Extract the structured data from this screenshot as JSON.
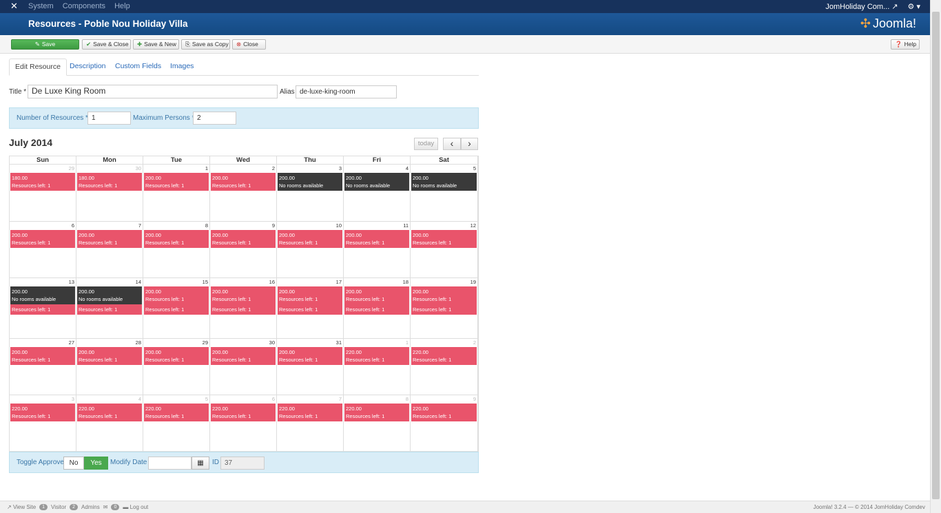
{
  "topbar": {
    "logo_icon": "joomla-x-icon",
    "menu": [
      "System",
      "Components",
      "Help"
    ],
    "site_link": "JomHoliday Com...",
    "settings_icon": "gear-icon"
  },
  "header": {
    "title": "Resources - Poble Nou Holiday Villa",
    "brand": "Joomla!"
  },
  "toolbar": {
    "save": "Save",
    "save_close": "Save & Close",
    "save_new": "Save & New",
    "save_copy": "Save as Copy",
    "close": "Close",
    "help": "Help"
  },
  "tabs": [
    "Edit Resource",
    "Description",
    "Custom Fields",
    "Images"
  ],
  "form": {
    "title_label": "Title *",
    "title_value": "De Luxe King Room",
    "alias_label": "Alias",
    "alias_value": "de-luxe-king-room",
    "num_label": "Number of Resources *",
    "num_value": "1",
    "max_label": "Maximum Persons *",
    "max_value": "2"
  },
  "calendar": {
    "month_title": "July 2014",
    "today": "today",
    "prev": "‹",
    "next": "›",
    "days": [
      "Sun",
      "Mon",
      "Tue",
      "Wed",
      "Thu",
      "Fri",
      "Sat"
    ],
    "weeks": [
      [
        {
          "d": "29",
          "o": true,
          "ev": [
            {
              "t": "180.00",
              "s": "Resources left: 1"
            }
          ]
        },
        {
          "d": "30",
          "o": true,
          "ev": [
            {
              "t": "180.00",
              "s": "Resources left: 1"
            }
          ]
        },
        {
          "d": "1",
          "ev": [
            {
              "t": "200.00",
              "s": "Resources left: 1"
            }
          ]
        },
        {
          "d": "2",
          "ev": [
            {
              "t": "200.00",
              "s": "Resources left: 1"
            }
          ]
        },
        {
          "d": "3",
          "ev": [
            {
              "t": "200.00",
              "s": "No rooms available",
              "k": "dark"
            }
          ]
        },
        {
          "d": "4",
          "ev": [
            {
              "t": "200.00",
              "s": "No rooms available",
              "k": "dark"
            }
          ]
        },
        {
          "d": "5",
          "ev": [
            {
              "t": "200.00",
              "s": "No rooms available",
              "k": "dark"
            }
          ]
        }
      ],
      [
        {
          "d": "6",
          "ev": [
            {
              "t": "200.00",
              "s": "Resources left: 1"
            }
          ]
        },
        {
          "d": "7",
          "ev": [
            {
              "t": "200.00",
              "s": "Resources left: 1"
            }
          ]
        },
        {
          "d": "8",
          "ev": [
            {
              "t": "200.00",
              "s": "Resources left: 1"
            }
          ]
        },
        {
          "d": "9",
          "ev": [
            {
              "t": "200.00",
              "s": "Resources left: 1"
            }
          ]
        },
        {
          "d": "10",
          "ev": [
            {
              "t": "200.00",
              "s": "Resources left: 1"
            }
          ]
        },
        {
          "d": "11",
          "ev": [
            {
              "t": "200.00",
              "s": "Resources left: 1"
            }
          ]
        },
        {
          "d": "12",
          "ev": [
            {
              "t": "200.00",
              "s": "Resources left: 1"
            }
          ]
        }
      ],
      [
        {
          "d": "13",
          "ev": [
            {
              "t": "200.00",
              "s": "No rooms available",
              "k": "dark"
            },
            {
              "t": "",
              "s": "Resources left: 1"
            }
          ]
        },
        {
          "d": "14",
          "ev": [
            {
              "t": "200.00",
              "s": "No rooms available",
              "k": "dark"
            },
            {
              "t": "",
              "s": "Resources left: 1"
            }
          ]
        },
        {
          "d": "15",
          "ev": [
            {
              "t": "200.00",
              "s": "Resources left: 1"
            },
            {
              "t": "",
              "s": "Resources left: 1"
            }
          ]
        },
        {
          "d": "16",
          "ev": [
            {
              "t": "200.00",
              "s": "Resources left: 1"
            },
            {
              "t": "",
              "s": "Resources left: 1"
            }
          ]
        },
        {
          "d": "17",
          "ev": [
            {
              "t": "200.00",
              "s": "Resources left: 1"
            },
            {
              "t": "",
              "s": "Resources left: 1"
            }
          ]
        },
        {
          "d": "18",
          "ev": [
            {
              "t": "200.00",
              "s": "Resources left: 1"
            },
            {
              "t": "",
              "s": "Resources left: 1"
            }
          ]
        },
        {
          "d": "19",
          "ev": [
            {
              "t": "200.00",
              "s": "Resources left: 1"
            },
            {
              "t": "",
              "s": "Resources left: 1"
            }
          ]
        }
      ],
      [
        {
          "d": "27",
          "ev": [
            {
              "t": "200.00",
              "s": "Resources left: 1"
            }
          ]
        },
        {
          "d": "28",
          "ev": [
            {
              "t": "200.00",
              "s": "Resources left: 1"
            }
          ]
        },
        {
          "d": "29",
          "ev": [
            {
              "t": "200.00",
              "s": "Resources left: 1"
            }
          ]
        },
        {
          "d": "30",
          "ev": [
            {
              "t": "200.00",
              "s": "Resources left: 1"
            }
          ]
        },
        {
          "d": "31",
          "ev": [
            {
              "t": "200.00",
              "s": "Resources left: 1"
            }
          ]
        },
        {
          "d": "1",
          "o": true,
          "ev": [
            {
              "t": "220.00",
              "s": "Resources left: 1"
            }
          ]
        },
        {
          "d": "2",
          "o": true,
          "ev": [
            {
              "t": "220.00",
              "s": "Resources left: 1"
            }
          ]
        }
      ],
      [
        {
          "d": "3",
          "o": true,
          "ev": [
            {
              "t": "220.00",
              "s": "Resources left: 1"
            }
          ]
        },
        {
          "d": "4",
          "o": true,
          "ev": [
            {
              "t": "220.00",
              "s": "Resources left: 1"
            }
          ]
        },
        {
          "d": "5",
          "o": true,
          "ev": [
            {
              "t": "220.00",
              "s": "Resources left: 1"
            }
          ]
        },
        {
          "d": "6",
          "o": true,
          "ev": [
            {
              "t": "220.00",
              "s": "Resources left: 1"
            }
          ]
        },
        {
          "d": "7",
          "o": true,
          "ev": [
            {
              "t": "220.00",
              "s": "Resources left: 1"
            }
          ]
        },
        {
          "d": "8",
          "o": true,
          "ev": [
            {
              "t": "220.00",
              "s": "Resources left: 1"
            }
          ]
        },
        {
          "d": "9",
          "o": true,
          "ev": [
            {
              "t": "220.00",
              "s": "Resources left: 1"
            }
          ]
        }
      ]
    ]
  },
  "footer_form": {
    "toggle_label": "Toggle Approve",
    "no": "No",
    "yes": "Yes",
    "modify_label": "Modify Date",
    "id_label": "ID",
    "id_value": "37"
  },
  "status": {
    "view_site": "View Site",
    "visitors_count": "1",
    "visitors": "Visitor",
    "admins_count": "2",
    "admins": "Admins",
    "messages_count": "0",
    "logout": "Log out",
    "version": "Joomla! 3.2.4 — © 2014 JomHoliday Comdev"
  },
  "colors": {
    "available": "#e9546b",
    "unavailable": "#3a3a3a",
    "header": "#1e5898",
    "save": "#4aa84e"
  }
}
